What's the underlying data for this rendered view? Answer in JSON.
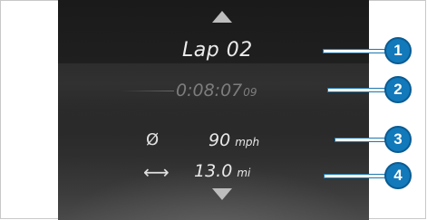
{
  "lap": {
    "title": "Lap 02",
    "time_main": "0:08:07",
    "time_hundredths": "09"
  },
  "stats": {
    "average_speed": {
      "icon": "Ø",
      "icon_name": "average-diameter-icon",
      "value": "90",
      "unit": "mph"
    },
    "distance": {
      "icon": "⟷",
      "icon_name": "double-arrow-icon",
      "value": "13.0",
      "unit": "mi"
    }
  },
  "callouts": [
    "1",
    "2",
    "3",
    "4"
  ],
  "colors": {
    "callout_badge": "#1279ba",
    "callout_line": "#ffffff",
    "screen_background": "#2a2a2a",
    "text_primary": "#e8e8e8",
    "text_dimmed": "#7d7d7d"
  }
}
